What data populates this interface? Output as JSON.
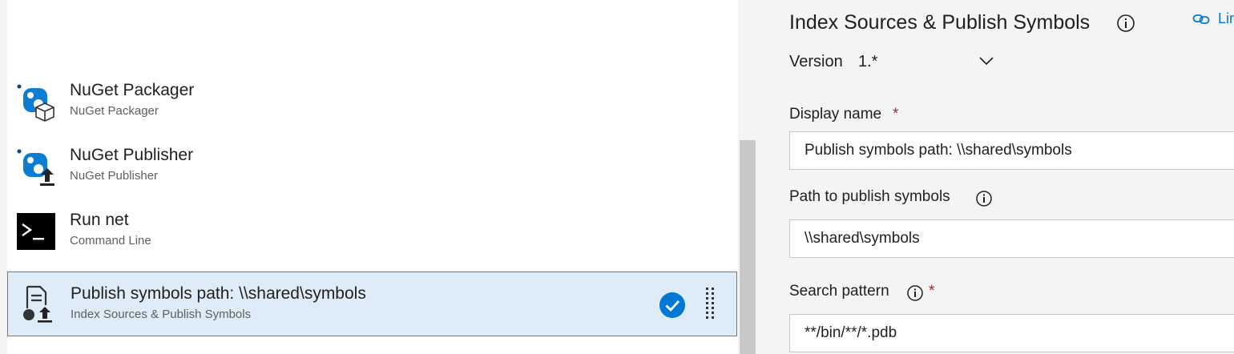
{
  "tasks": [
    {
      "title": "NuGet Packager",
      "subtitle": "NuGet Packager",
      "icon": "nuget-packager-icon"
    },
    {
      "title": "NuGet Publisher",
      "subtitle": "NuGet Publisher",
      "icon": "nuget-publisher-icon"
    },
    {
      "title": "Run net",
      "subtitle": "Command Line",
      "icon": "command-line-icon"
    },
    {
      "title": "Publish symbols path: \\\\shared\\symbols",
      "subtitle": "Index Sources & Publish Symbols",
      "icon": "publish-symbols-icon",
      "selected": true
    }
  ],
  "details": {
    "title": "Index Sources & Publish Symbols",
    "link_text": "Lir",
    "version_label": "Version",
    "version_value": "1.*",
    "fields": {
      "display_name": {
        "label": "Display name",
        "required": "*",
        "value": "Publish symbols path: \\\\shared\\symbols"
      },
      "symbols_path": {
        "label": "Path to publish symbols",
        "value": "\\\\shared\\symbols"
      },
      "search_pattern": {
        "label": "Search pattern",
        "required": "*",
        "value": "**/bin/**/*.pdb"
      }
    }
  },
  "colors": {
    "accent": "#0078d4",
    "selected_row": "#deecf9",
    "required": "#a4262c",
    "panel_bg": "#f4f4f4"
  }
}
